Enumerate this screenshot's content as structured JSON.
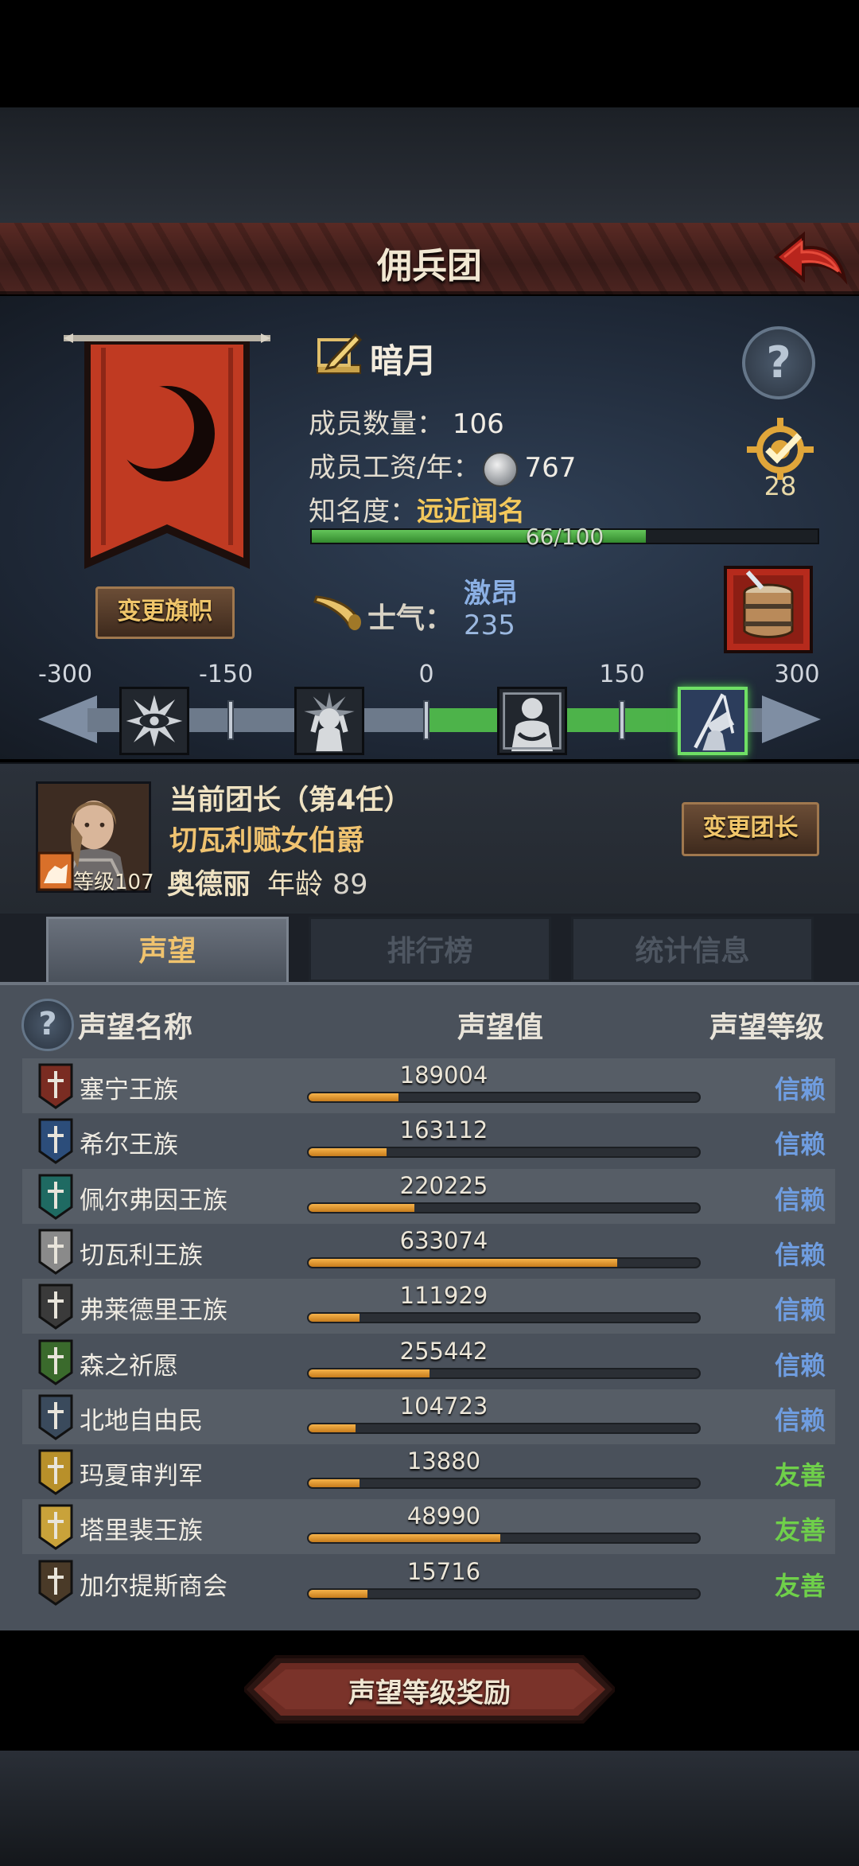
{
  "header": {
    "title": "佣兵团"
  },
  "guild": {
    "name": "暗月",
    "change_flag_label": "变更旗帜",
    "members_label": "成员数量：",
    "members_value": "106",
    "salary_label": "成员工资/年：",
    "salary_value": "767",
    "fame_label": "知名度：",
    "fame_value": "远近闻名",
    "fame_progress_text": "66/100",
    "fame_progress_fraction": 0.66,
    "target_count": "28",
    "morale_label": "士气：",
    "morale_state": "激昂",
    "morale_value": "235"
  },
  "morale_scale": {
    "ticks": [
      "-300",
      "-150",
      "0",
      "150",
      "300"
    ],
    "icons": [
      "eye-icon",
      "despair-icon",
      "calm-icon",
      "victory-banner-icon"
    ],
    "active_icon_index": 3
  },
  "leader": {
    "title": "当前团长（第4任）",
    "name": "切瓦利赋女伯爵",
    "level_label": "等级107",
    "given_name": "奥德丽",
    "age_label": "年龄",
    "age_value": "89",
    "change_label": "变更团长"
  },
  "tabs": [
    "声望",
    "排行榜",
    "统计信息"
  ],
  "active_tab_index": 0,
  "reputation": {
    "headers": {
      "name": "声望名称",
      "value": "声望值",
      "level": "声望等级"
    },
    "rows": [
      {
        "name": "塞宁王族",
        "value": "189004",
        "fill": 0.23,
        "level": "信赖",
        "crest_color": "#7a2c22"
      },
      {
        "name": "希尔王族",
        "value": "163112",
        "fill": 0.2,
        "level": "信赖",
        "crest_color": "#2c4d7a"
      },
      {
        "name": "佩尔弗因王族",
        "value": "220225",
        "fill": 0.27,
        "level": "信赖",
        "crest_color": "#1f6a62"
      },
      {
        "name": "切瓦利王族",
        "value": "633074",
        "fill": 0.79,
        "level": "信赖",
        "crest_color": "#8a8a8a"
      },
      {
        "name": "弗莱德里王族",
        "value": "111929",
        "fill": 0.13,
        "level": "信赖",
        "crest_color": "#3a3a3a"
      },
      {
        "name": "森之祈愿",
        "value": "255442",
        "fill": 0.31,
        "level": "信赖",
        "crest_color": "#3a6a2c"
      },
      {
        "name": "北地自由民",
        "value": "104723",
        "fill": 0.12,
        "level": "信赖",
        "crest_color": "#3a4a5c"
      },
      {
        "name": "玛夏审判军",
        "value": "13880",
        "fill": 0.13,
        "level": "友善",
        "crest_color": "#b8902a"
      },
      {
        "name": "塔里裴王族",
        "value": "48990",
        "fill": 0.49,
        "level": "友善",
        "crest_color": "#c9a23a"
      },
      {
        "name": "加尔提斯商会",
        "value": "15716",
        "fill": 0.15,
        "level": "友善",
        "crest_color": "#4a3a28"
      }
    ]
  },
  "reward_button": {
    "label": "声望等级奖励"
  },
  "colors": {
    "trust_level": "#6f9de0",
    "friendly_level": "#6fd04a",
    "accent_gold": "#f0c36e",
    "progress_orange": "#e0962e"
  }
}
